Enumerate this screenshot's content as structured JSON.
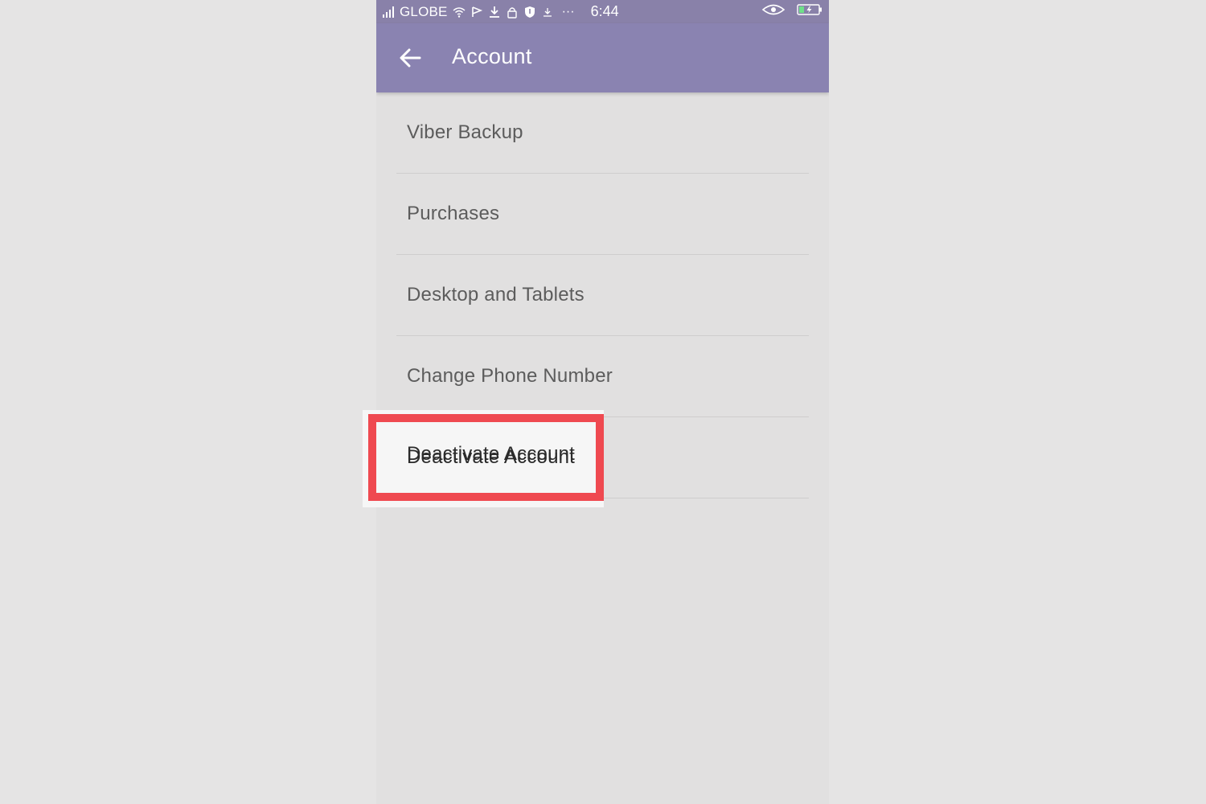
{
  "status_bar": {
    "carrier": "GLOBE",
    "time": "6:44",
    "icons": [
      "signal-icon",
      "wifi-icon",
      "flag-icon",
      "download-icon",
      "lock-icon",
      "shield-icon",
      "download-small-icon",
      "more-dots-icon",
      "eye-icon",
      "battery-charging-icon"
    ],
    "overflow_dots": "···"
  },
  "app_bar": {
    "title": "Account",
    "back_icon": "arrow-left-icon"
  },
  "menu": {
    "items": [
      {
        "label": "Viber Backup"
      },
      {
        "label": "Purchases"
      },
      {
        "label": "Desktop and Tablets"
      },
      {
        "label": "Change Phone Number"
      },
      {
        "label": "Deactivate Account",
        "highlighted": true
      }
    ]
  },
  "colors": {
    "app_bar": "#8a83b1",
    "status_bar": "#8981a9",
    "highlight": "#ef4950",
    "background": "#e1e0e0"
  }
}
